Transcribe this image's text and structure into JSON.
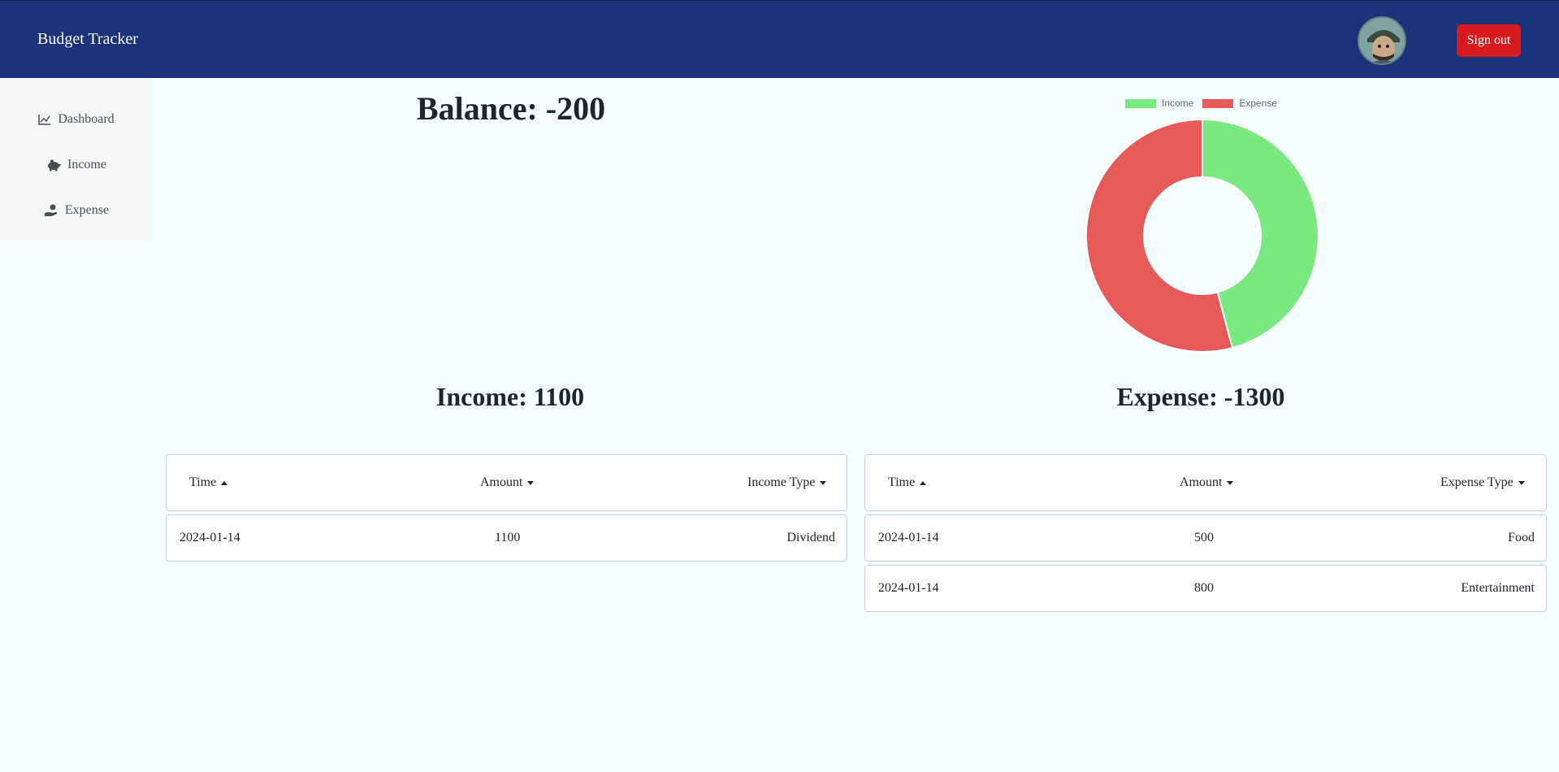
{
  "app": {
    "title": "Budget Tracker"
  },
  "header": {
    "signout_label": "Sign out"
  },
  "sidebar": {
    "items": [
      {
        "label": "Dashboard",
        "icon": "chart-line-icon"
      },
      {
        "label": "Income",
        "icon": "piggy-bank-icon"
      },
      {
        "label": "Expense",
        "icon": "hand-holding-dollar-icon"
      }
    ]
  },
  "summary": {
    "balance": "Balance: -200",
    "income": "Income: 1100",
    "expense": "Expense: -1300"
  },
  "colors": {
    "income": "#7ae982",
    "expense": "#e65a5a",
    "navbar": "#1b337a",
    "signout": "#d71920"
  },
  "chart_data": {
    "type": "pie",
    "categories": [
      "Income",
      "Expense"
    ],
    "values": [
      1100,
      1300
    ],
    "legend": "top",
    "colors": [
      "#7ae982",
      "#e65a5a"
    ]
  },
  "income_table": {
    "headers": [
      "Time",
      "Amount",
      "Income Type"
    ],
    "sort": [
      "up",
      "down",
      "down"
    ],
    "rows": [
      [
        "2024-01-14",
        "1100",
        "Dividend"
      ]
    ]
  },
  "expense_table": {
    "headers": [
      "Time",
      "Amount",
      "Expense Type"
    ],
    "sort": [
      "up",
      "down",
      "down"
    ],
    "rows": [
      [
        "2024-01-14",
        "500",
        "Food"
      ],
      [
        "2024-01-14",
        "800",
        "Entertainment"
      ]
    ]
  }
}
